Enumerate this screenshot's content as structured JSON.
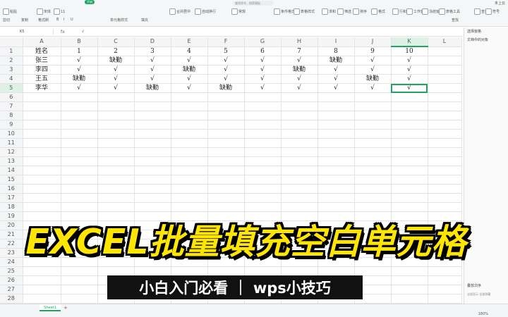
{
  "ribbon": {
    "active_tab": "开始",
    "search_placeholder": "查找命令、搜索模板",
    "user_label": "未上云",
    "row1": [
      {
        "label": "粘贴",
        "icon": "paste-icon"
      },
      {
        "label": "宋体",
        "icon": "font-icon"
      },
      {
        "label": "11",
        "icon": "font-size-icon"
      },
      {
        "label": "合并居中",
        "icon": "merge-icon"
      },
      {
        "label": "自动换行",
        "icon": "wrap-icon"
      },
      {
        "label": "常规",
        "icon": "number-format-icon"
      },
      {
        "label": "条件格式",
        "icon": "conditional-format-icon"
      },
      {
        "label": "表格样式",
        "icon": "table-style-icon"
      },
      {
        "label": "求和",
        "icon": "sum-icon"
      },
      {
        "label": "筛选",
        "icon": "filter-icon"
      },
      {
        "label": "排序",
        "icon": "sort-icon"
      },
      {
        "label": "格式",
        "icon": "format-icon"
      },
      {
        "label": "行和列",
        "icon": "rows-cols-icon"
      },
      {
        "label": "工作表",
        "icon": "sheet-icon"
      },
      {
        "label": "冻结窗格",
        "icon": "freeze-icon"
      },
      {
        "label": "表格工具",
        "icon": "tools-icon"
      },
      {
        "label": "查找",
        "icon": "find-icon"
      },
      {
        "label": "符号",
        "icon": "symbol-icon"
      }
    ],
    "row2": [
      "剪切",
      "复制",
      "格式刷",
      "B",
      "I",
      "U",
      "单元格样式",
      "填充",
      "查找"
    ]
  },
  "formula_bar": {
    "name_box": "K5",
    "fx": "fx",
    "value": "√"
  },
  "grid": {
    "columns": [
      "A",
      "B",
      "C",
      "D",
      "E",
      "F",
      "G",
      "H",
      "I",
      "J",
      "K",
      "L"
    ],
    "selected_column": "K",
    "selected_row": 5,
    "rows": [
      {
        "num": "1",
        "cells": [
          "姓名",
          "1",
          "2",
          "3",
          "4",
          "5",
          "6",
          "7",
          "8",
          "9",
          "10",
          ""
        ]
      },
      {
        "num": "2",
        "cells": [
          "张三",
          "√",
          "缺勤",
          "√",
          "√",
          "√",
          "√",
          "√",
          "缺勤",
          "√",
          "√",
          ""
        ]
      },
      {
        "num": "3",
        "cells": [
          "李四",
          "√",
          "√",
          "√",
          "缺勤",
          "√",
          "√",
          "缺勤",
          "√",
          "√",
          "√",
          ""
        ]
      },
      {
        "num": "4",
        "cells": [
          "王五",
          "缺勤",
          "√",
          "√",
          "√",
          "√",
          "√",
          "√",
          "√",
          "缺勤",
          "√",
          ""
        ]
      },
      {
        "num": "5",
        "cells": [
          "李华",
          "√",
          "√",
          "缺勤",
          "√",
          "缺勤",
          "√",
          "√",
          "√",
          "√",
          "√",
          ""
        ]
      },
      {
        "num": "6",
        "cells": [
          "",
          "",
          "",
          "",
          "",
          "",
          "",
          "",
          "",
          "",
          "",
          ""
        ]
      },
      {
        "num": "7",
        "cells": [
          "",
          "",
          "",
          "",
          "",
          "",
          "",
          "",
          "",
          "",
          "",
          ""
        ]
      },
      {
        "num": "8",
        "cells": [
          "",
          "",
          "",
          "",
          "",
          "",
          "",
          "",
          "",
          "",
          "",
          ""
        ]
      },
      {
        "num": "9",
        "cells": [
          "",
          "",
          "",
          "",
          "",
          "",
          "",
          "",
          "",
          "",
          "",
          ""
        ]
      },
      {
        "num": "10",
        "cells": [
          "",
          "",
          "",
          "",
          "",
          "",
          "",
          "",
          "",
          "",
          "",
          ""
        ]
      },
      {
        "num": "11",
        "cells": [
          "",
          "",
          "",
          "",
          "",
          "",
          "",
          "",
          "",
          "",
          "",
          ""
        ]
      },
      {
        "num": "12",
        "cells": [
          "",
          "",
          "",
          "",
          "",
          "",
          "",
          "",
          "",
          "",
          "",
          ""
        ]
      },
      {
        "num": "13",
        "cells": [
          "",
          "",
          "",
          "",
          "",
          "",
          "",
          "",
          "",
          "",
          "",
          ""
        ]
      },
      {
        "num": "14",
        "cells": [
          "",
          "",
          "",
          "",
          "",
          "",
          "",
          "",
          "",
          "",
          "",
          ""
        ]
      },
      {
        "num": "15",
        "cells": [
          "",
          "",
          "",
          "",
          "",
          "",
          "",
          "",
          "",
          "",
          "",
          ""
        ]
      },
      {
        "num": "16",
        "cells": [
          "",
          "",
          "",
          "",
          "",
          "",
          "",
          "",
          "",
          "",
          "",
          ""
        ]
      },
      {
        "num": "17",
        "cells": [
          "",
          "",
          "",
          "",
          "",
          "",
          "",
          "",
          "",
          "",
          "",
          ""
        ]
      },
      {
        "num": "18",
        "cells": [
          "",
          "",
          "",
          "",
          "",
          "",
          "",
          "",
          "",
          "",
          "",
          ""
        ]
      },
      {
        "num": "19",
        "cells": [
          "",
          "",
          "",
          "",
          "",
          "",
          "",
          "",
          "",
          "",
          "",
          ""
        ]
      },
      {
        "num": "20",
        "cells": [
          "",
          "",
          "",
          "",
          "",
          "",
          "",
          "",
          "",
          "",
          "",
          ""
        ]
      },
      {
        "num": "21",
        "cells": [
          "",
          "",
          "",
          "",
          "",
          "",
          "",
          "",
          "",
          "",
          "",
          ""
        ]
      },
      {
        "num": "22",
        "cells": [
          "",
          "",
          "",
          "",
          "",
          "",
          "",
          "",
          "",
          "",
          "",
          ""
        ]
      },
      {
        "num": "23",
        "cells": [
          "",
          "",
          "",
          "",
          "",
          "",
          "",
          "",
          "",
          "",
          "",
          ""
        ]
      },
      {
        "num": "24",
        "cells": [
          "",
          "",
          "",
          "",
          "",
          "",
          "",
          "",
          "",
          "",
          "",
          ""
        ]
      },
      {
        "num": "25",
        "cells": [
          "",
          "",
          "",
          "",
          "",
          "",
          "",
          "",
          "",
          "",
          "",
          ""
        ]
      },
      {
        "num": "26",
        "cells": [
          "",
          "",
          "",
          "",
          "",
          "",
          "",
          "",
          "",
          "",
          "",
          ""
        ]
      },
      {
        "num": "27",
        "cells": [
          "",
          "",
          "",
          "",
          "",
          "",
          "",
          "",
          "",
          "",
          "",
          ""
        ]
      },
      {
        "num": "28",
        "cells": [
          "",
          "",
          "",
          "",
          "",
          "",
          "",
          "",
          "",
          "",
          "",
          ""
        ]
      }
    ]
  },
  "right_panel": {
    "title": "选择窗格",
    "subtitle": "文档中的对象",
    "bottom_label": "叠放次序",
    "buttons": "全部显示   全部隐藏"
  },
  "sheet_tabs": {
    "tabs": [
      "Sheet1"
    ],
    "add_label": "+"
  },
  "status": {
    "zoom": "180%"
  },
  "overlay": {
    "title": "EXCEL批量填充空白单元格",
    "subtitle": "小白入门必看 ｜ wps小技巧"
  },
  "colors": {
    "accent": "#21a366",
    "title_yellow": "#ffe600",
    "banner_bg": "#111111"
  }
}
